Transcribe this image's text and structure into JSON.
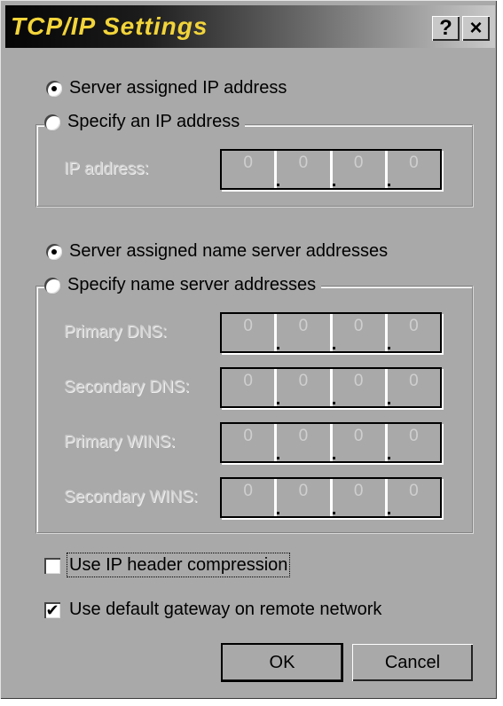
{
  "window": {
    "title": "TCP/IP Settings",
    "help_button": "?",
    "close_button": "×"
  },
  "ip_section": {
    "server_assigned_label": "Server assigned IP address",
    "server_assigned_selected": true,
    "specify_label": "Specify an IP address",
    "specify_selected": false,
    "ip_address_label": "IP address:",
    "ip_address": [
      "0",
      "0",
      "0",
      "0"
    ]
  },
  "dns_section": {
    "server_assigned_label": "Server assigned name server addresses",
    "server_assigned_selected": true,
    "specify_label": "Specify name server addresses",
    "specify_selected": false,
    "fields": [
      {
        "label": "Primary DNS:",
        "octets": [
          "0",
          "0",
          "0",
          "0"
        ]
      },
      {
        "label": "Secondary DNS:",
        "octets": [
          "0",
          "0",
          "0",
          "0"
        ]
      },
      {
        "label": "Primary WINS:",
        "octets": [
          "0",
          "0",
          "0",
          "0"
        ]
      },
      {
        "label": "Secondary WINS:",
        "octets": [
          "0",
          "0",
          "0",
          "0"
        ]
      }
    ]
  },
  "options": {
    "header_compression_label": "Use IP header compression",
    "header_compression_checked": false,
    "default_gateway_label": "Use default gateway on remote network",
    "default_gateway_checked": true
  },
  "buttons": {
    "ok": "OK",
    "cancel": "Cancel"
  }
}
